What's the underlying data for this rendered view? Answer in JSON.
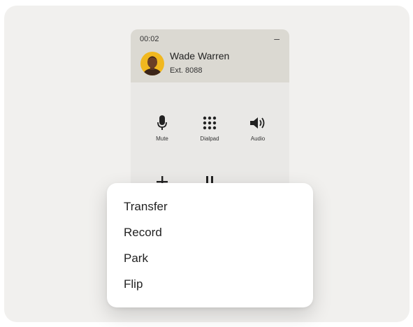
{
  "call": {
    "timer": "00:02",
    "minimize_label": "–",
    "caller_name": "Wade Warren",
    "caller_ext": "Ext. 8088"
  },
  "controls": [
    {
      "label": "Mute",
      "icon": "microphone-icon"
    },
    {
      "label": "Dialpad",
      "icon": "dialpad-icon"
    },
    {
      "label": "Audio",
      "icon": "speaker-icon"
    },
    {
      "label": "",
      "icon": "add-icon"
    },
    {
      "label": "",
      "icon": "hold-icon"
    },
    {
      "label": "",
      "icon": "more-icon"
    }
  ],
  "menu": {
    "items": [
      {
        "label": "Transfer"
      },
      {
        "label": "Record"
      },
      {
        "label": "Park"
      },
      {
        "label": "Flip"
      }
    ]
  },
  "colors": {
    "page_bg": "#f1f0ee",
    "header_bg": "#dbd9d2",
    "widget_bg": "#e9e8e6",
    "avatar_bg": "#f1b81f"
  }
}
